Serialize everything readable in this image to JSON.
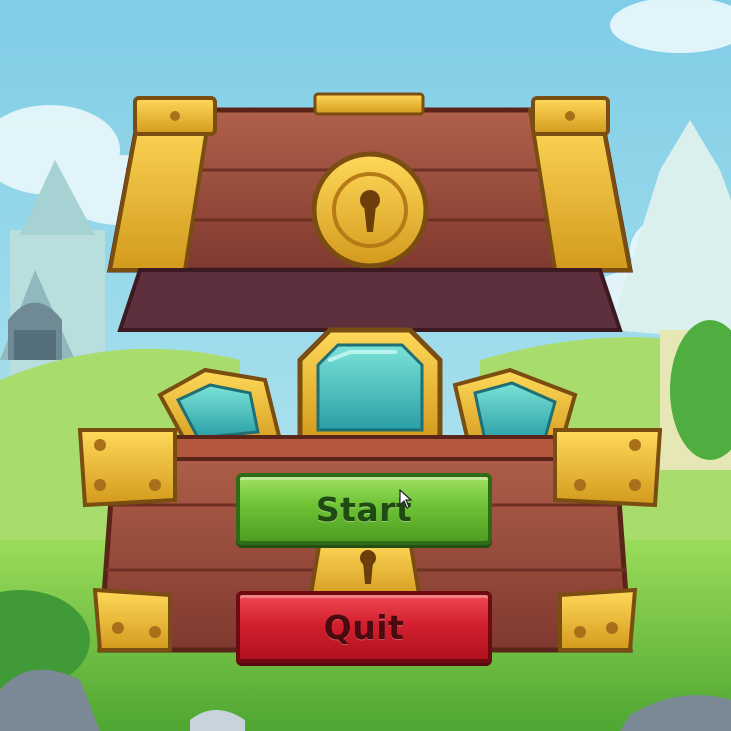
{
  "menu": {
    "start_label": "Start",
    "quit_label": "Quit"
  },
  "colors": {
    "sky": "#8ed3e8",
    "grass": "#7fcf4a",
    "wood": "#9a4b3a",
    "gold": "#e9b52a",
    "gem": "#3fbcb8",
    "start_button": "#6ec235",
    "quit_button": "#d3202e"
  },
  "icons": [
    "keyhole-icon",
    "cursor-arrow-icon"
  ]
}
